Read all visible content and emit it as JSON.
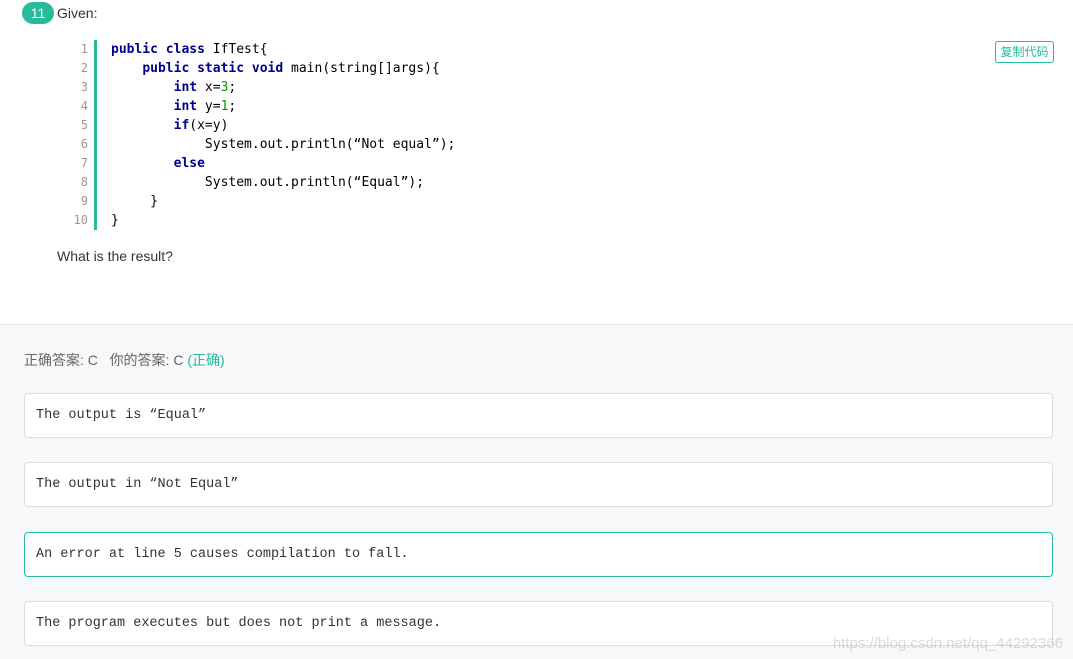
{
  "question": {
    "number": "11",
    "given_label": "Given:",
    "copy_button_label": "复制代码",
    "line_numbers": [
      "1",
      "2",
      "3",
      "4",
      "5",
      "6",
      "7",
      "8",
      "9",
      "10"
    ],
    "code_lines": [
      [
        {
          "t": "public class",
          "c": "kw"
        },
        {
          "t": " IfTest{",
          "c": ""
        }
      ],
      [
        {
          "t": "    ",
          "c": ""
        },
        {
          "t": "public static void",
          "c": "kw"
        },
        {
          "t": " main(string[]args){",
          "c": ""
        }
      ],
      [
        {
          "t": "        ",
          "c": ""
        },
        {
          "t": "int",
          "c": "kw"
        },
        {
          "t": " x=",
          "c": ""
        },
        {
          "t": "3",
          "c": "num"
        },
        {
          "t": ";",
          "c": ""
        }
      ],
      [
        {
          "t": "        ",
          "c": ""
        },
        {
          "t": "int",
          "c": "kw"
        },
        {
          "t": " y=",
          "c": ""
        },
        {
          "t": "1",
          "c": "num"
        },
        {
          "t": ";",
          "c": ""
        }
      ],
      [
        {
          "t": "        ",
          "c": ""
        },
        {
          "t": "if",
          "c": "kw"
        },
        {
          "t": "(x=y)",
          "c": ""
        }
      ],
      [
        {
          "t": "            System.out.println(“Not equal”);",
          "c": ""
        }
      ],
      [
        {
          "t": "        ",
          "c": ""
        },
        {
          "t": "else",
          "c": "kw"
        }
      ],
      [
        {
          "t": "            System.out.println(“Equal”);",
          "c": ""
        }
      ],
      [
        {
          "t": "     }",
          "c": ""
        }
      ],
      [
        {
          "t": "}",
          "c": ""
        }
      ]
    ],
    "prompt": "What is the result?"
  },
  "answer": {
    "correct_label": "正确答案: C",
    "your_label": "你的答案: C",
    "result_tag": "(正确)"
  },
  "options": [
    {
      "text": "The output is “Equal”",
      "selected": false
    },
    {
      "text": "The output in “Not Equal”",
      "selected": false
    },
    {
      "text": "An error at line 5 causes compilation to fall.",
      "selected": true
    },
    {
      "text": "The program executes but does not print a message.",
      "selected": false
    }
  ],
  "watermark": "https://blog.csdn.net/qq_44292366",
  "colors": {
    "accent": "#25bb9b",
    "keyword": "#00008b",
    "number": "#009900"
  }
}
